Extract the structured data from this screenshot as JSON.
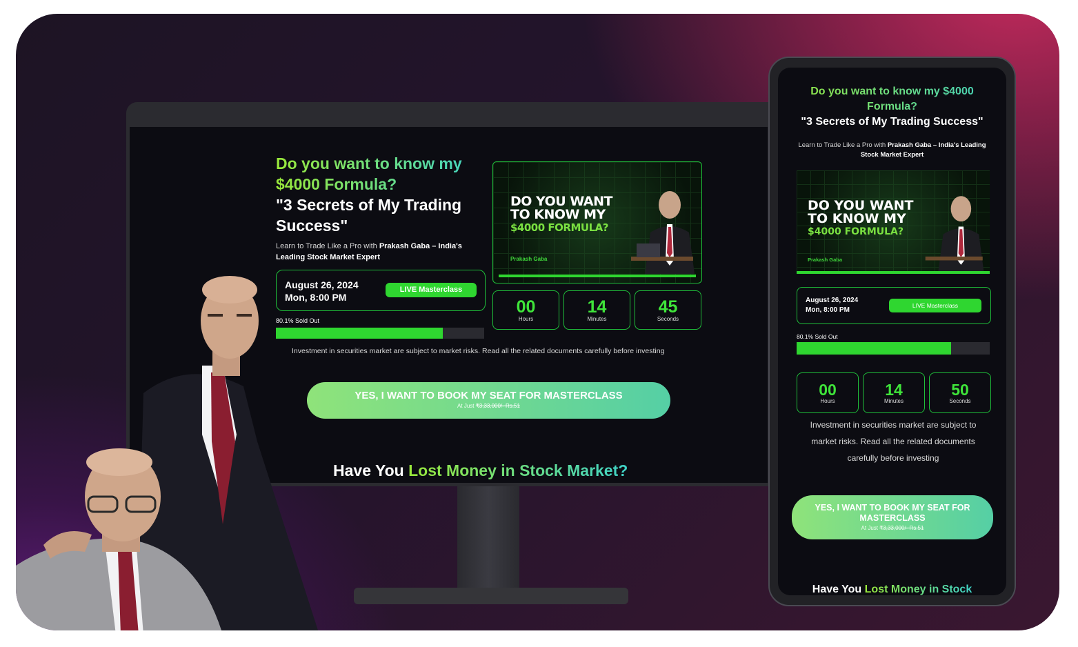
{
  "desktop": {
    "headline_q": "Do you want to know my $4000 Formula?",
    "headline_s": "\"3 Secrets of My Trading Success\"",
    "sub_pre": "Learn to Trade Like a Pro with ",
    "sub_bold": "Prakash Gaba – India's Leading Stock Market Expert",
    "date_line1": "August 26, 2024",
    "date_line2": "Mon, 8:00 PM",
    "live_label": "LIVE Masterclass",
    "sold_text": "80.1% Sold Out",
    "sold_fraction": 0.801,
    "thumb_line1": "DO YOU WANT",
    "thumb_line2": "TO KNOW MY",
    "thumb_line3": "$4000 FORMULA?",
    "thumb_name_a": "Prakash",
    "thumb_name_b": "Gaba",
    "countdown": [
      {
        "value": "00",
        "label": "Hours"
      },
      {
        "value": "14",
        "label": "Minutes"
      },
      {
        "value": "45",
        "label": "Seconds"
      }
    ],
    "risk_text": "Investment in securities market are subject to market risks. Read all the related documents carefully before investing",
    "cta_label": "YES, I WANT TO BOOK MY SEAT FOR MASTERCLASS",
    "cta_price_pre": "At Just ",
    "cta_price_strike": "₹3,33,000/- Rs.51",
    "lost_a": "Have You ",
    "lost_b": "Lost Money in Stock Market?"
  },
  "mobile": {
    "headline_q1": "Do you want to know my $4000",
    "headline_q2": "Formula?",
    "headline_s": "\"3 Secrets of My Trading Success\"",
    "sub_pre": "Learn to Trade Like a Pro with ",
    "sub_bold": "Prakash Gaba – India's Leading Stock Market Expert",
    "date_line1": "August 26, 2024",
    "date_line2": "Mon, 8:00 PM",
    "live_label": "LIVE Masterclass",
    "sold_text": "80.1% Sold Out",
    "sold_fraction": 0.801,
    "thumb_line1": "DO YOU WANT",
    "thumb_line2": "TO KNOW MY",
    "thumb_line3": "$4000 FORMULA?",
    "thumb_name_a": "Prakash",
    "thumb_name_b": "Gaba",
    "countdown": [
      {
        "value": "00",
        "label": "Hours"
      },
      {
        "value": "14",
        "label": "Minutes"
      },
      {
        "value": "50",
        "label": "Seconds"
      }
    ],
    "risk_text": "Investment in securities market are subject to market risks. Read all the related documents carefully before investing",
    "cta_line1": "YES, I WANT TO BOOK MY SEAT FOR",
    "cta_line2": "MASTERCLASS",
    "cta_price_pre": "At Just ",
    "cta_price_strike": "₹3,33,000/- Rs.51",
    "lost_a": "Have You ",
    "lost_b": "Lost Money in Stock"
  },
  "colors": {
    "accent_green": "#2fd630",
    "gradient_start": "#9ae83a",
    "gradient_end": "#3fd3c8"
  }
}
